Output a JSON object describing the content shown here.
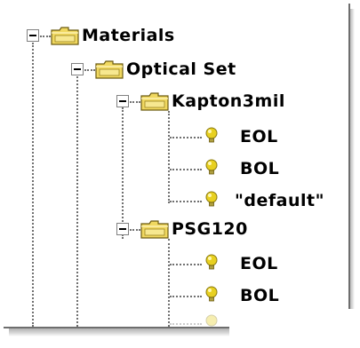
{
  "tree": {
    "materials": {
      "label": "Materials",
      "optical_set": {
        "label": "Optical Set",
        "kapton": {
          "label": "Kapton3mil",
          "children": [
            "EOL",
            "BOL",
            "\"default\""
          ]
        },
        "psg": {
          "label": "PSG120",
          "children": [
            "EOL",
            "BOL"
          ]
        }
      }
    }
  },
  "icons": {
    "folder": "folder-icon",
    "leaf": "bulb-icon",
    "toggle": "collapse-minus-icon"
  },
  "colors": {
    "folder_fill": "#f0d860",
    "bulb_fill": "#e8d020",
    "tree_line": "#707070"
  }
}
